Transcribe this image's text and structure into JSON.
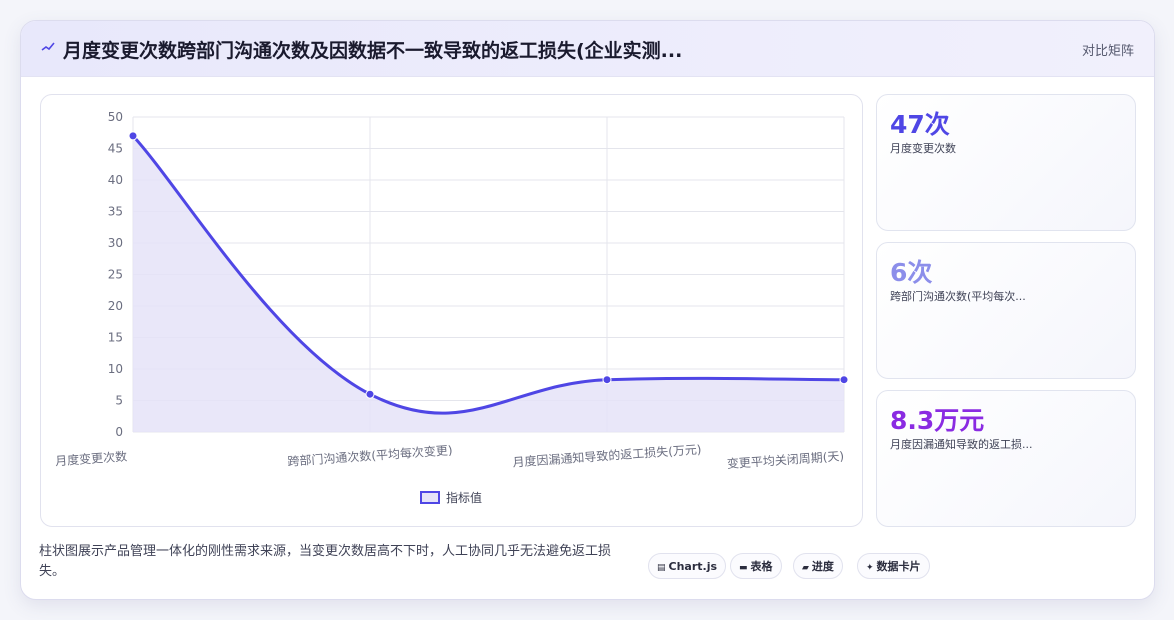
{
  "header": {
    "icon": "sparkline-icon",
    "title": "月度变更次数跨部门沟通次数及因数据不一致导致的返工损失(企业实测...",
    "compare_label": "对比矩阵"
  },
  "chart_data": {
    "type": "line",
    "fill": true,
    "smooth": true,
    "categories": [
      "月度变更次数",
      "跨部门沟通次数(平均每次变更)",
      "月度因漏通知导致的返工损失(万元)",
      "变更平均关闭周期(天)"
    ],
    "series": [
      {
        "name": "指标值",
        "values": [
          47,
          6,
          8.3,
          8.3
        ]
      }
    ],
    "ylim": [
      0,
      50
    ],
    "yticks": [
      "0",
      "5",
      "10",
      "15",
      "20",
      "25",
      "30",
      "35",
      "40",
      "45",
      "50"
    ],
    "grid": true,
    "legend_position": "bottom",
    "colors": {
      "line": "#4f46e5",
      "fill": "#e5e3f8",
      "grid": "#e4e5ec",
      "tick": "#6b6e80"
    }
  },
  "kpis": [
    {
      "value": "47次",
      "label": "月度变更次数",
      "color": "#4f46e5"
    },
    {
      "value": "6次",
      "label": "跨部门沟通次数(平均每次...",
      "color": "#8c8eea"
    },
    {
      "value": "8.3万元",
      "label": "月度因漏通知导致的返工损...",
      "color": "#8a2be2"
    }
  ],
  "footer": {
    "note": "柱状图展示产品管理一体化的刚性需求来源，当变更次数居高不下时，人工协同几乎无法避免返工损失。",
    "chips": [
      {
        "icon": "chart-icon",
        "glyph": "▤",
        "label": "Chart.js"
      },
      {
        "icon": "table-icon",
        "glyph": "▬",
        "label": "表格"
      },
      {
        "icon": "progress-icon",
        "glyph": "▰",
        "label": "进度"
      },
      {
        "icon": "sparkle-icon",
        "glyph": "✦",
        "label": "数据卡片"
      }
    ]
  }
}
